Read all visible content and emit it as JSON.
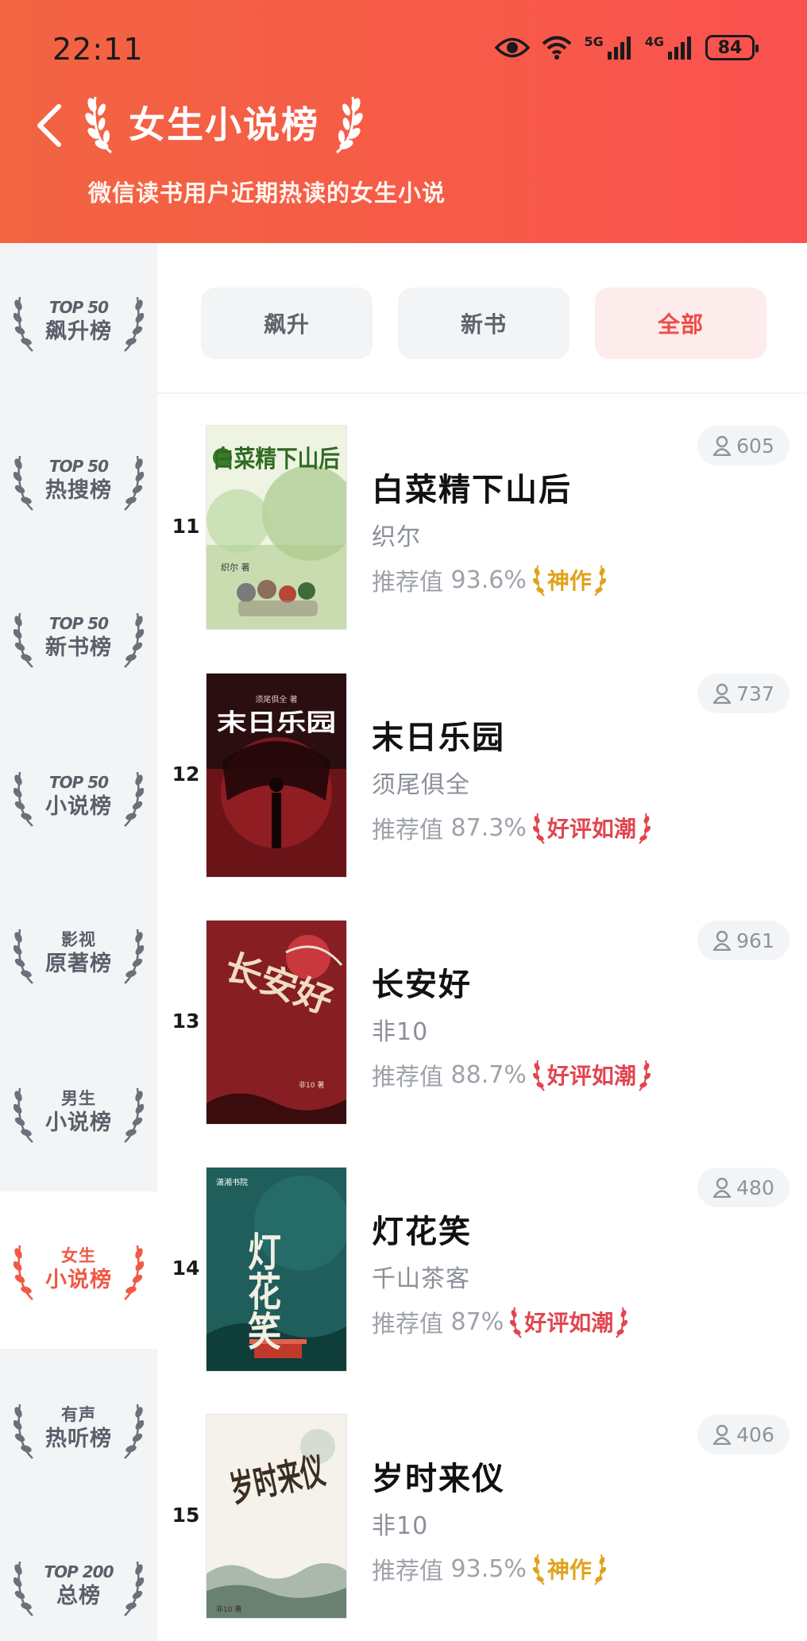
{
  "status_bar": {
    "time": "22:11",
    "network_5g": "5G",
    "network_4g": "4G",
    "battery": "84"
  },
  "header": {
    "title": "女生小说榜",
    "subtitle": "微信读书用户近期热读的女生小说"
  },
  "sidebar": {
    "items": [
      {
        "top": "TOP 50",
        "main": "飙升榜",
        "active": false
      },
      {
        "top": "TOP 50",
        "main": "热搜榜",
        "active": false
      },
      {
        "top": "TOP 50",
        "main": "新书榜",
        "active": false
      },
      {
        "top": "TOP 50",
        "main": "小说榜",
        "active": false
      },
      {
        "top": "影视",
        "main": "原著榜",
        "active": false
      },
      {
        "top": "男生",
        "main": "小说榜",
        "active": false
      },
      {
        "top": "女生",
        "main": "小说榜",
        "active": true
      },
      {
        "top": "有声",
        "main": "热听榜",
        "active": false
      },
      {
        "top": "TOP 200",
        "main": "总榜",
        "active": false
      }
    ]
  },
  "filters": {
    "items": [
      "飙升",
      "新书",
      "全部"
    ],
    "active": "全部"
  },
  "colors": {
    "header_start": "#f26442",
    "header_end": "#fa5150",
    "accent": "#f04b45",
    "gold": "#e0a21a",
    "praise": "#e2454f"
  },
  "books": [
    {
      "rank": "11",
      "title": "白菜精下山后",
      "author": "织尔",
      "rec_label": "推荐值",
      "rec_value": "93.6%",
      "badge": "神作",
      "badge_type": "gold",
      "readers": "605",
      "cover": "cartoon-green"
    },
    {
      "rank": "12",
      "title": "末日乐园",
      "author": "须尾俱全",
      "rec_label": "推荐值",
      "rec_value": "87.3%",
      "badge": "好评如潮",
      "badge_type": "red",
      "readers": "737",
      "cover": "dark-red"
    },
    {
      "rank": "13",
      "title": "长安好",
      "author": "非10",
      "rec_label": "推荐值",
      "rec_value": "88.7%",
      "badge": "好评如潮",
      "badge_type": "red",
      "readers": "961",
      "cover": "crimson"
    },
    {
      "rank": "14",
      "title": "灯花笑",
      "author": "千山茶客",
      "rec_label": "推荐值",
      "rec_value": "87%",
      "badge": "好评如潮",
      "badge_type": "red",
      "readers": "480",
      "cover": "teal"
    },
    {
      "rank": "15",
      "title": "岁时来仪",
      "author": "非10",
      "rec_label": "推荐值",
      "rec_value": "93.5%",
      "badge": "神作",
      "badge_type": "gold",
      "readers": "406",
      "cover": "ink-white"
    }
  ],
  "covers": {
    "book1_title": "白菜精下山后",
    "book1_author": "织尔 著",
    "book2_title": "末日乐园",
    "book2_author": "须尾俱全 著",
    "book3_title": "长安好",
    "book3_author": "非10 著",
    "book4_title": "灯花笑",
    "book4_publisher": "潇湘书院",
    "book5_title": "岁时来仪",
    "book5_author": "非10 著"
  }
}
